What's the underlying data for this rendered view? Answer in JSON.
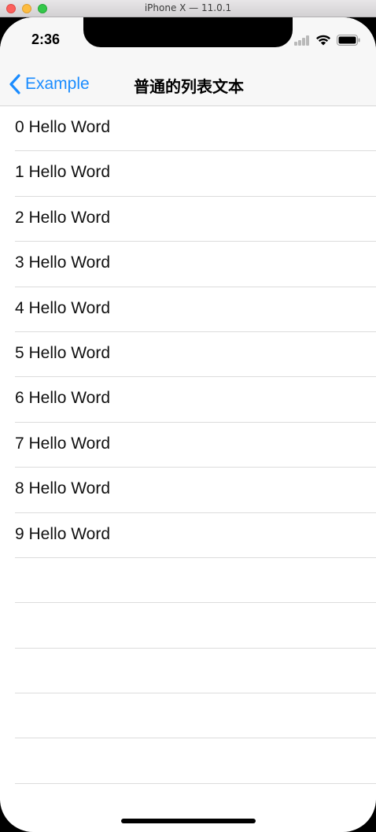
{
  "window": {
    "title": "iPhone X — 11.0.1"
  },
  "status_bar": {
    "time": "2:36"
  },
  "nav": {
    "back_label": "Example",
    "title": "普通的列表文本"
  },
  "list": {
    "items": [
      "0 Hello Word",
      "1 Hello Word",
      "2 Hello Word",
      "3 Hello Word",
      "4 Hello Word",
      "5 Hello Word",
      "6 Hello Word",
      "7 Hello Word",
      "8 Hello Word",
      "9 Hello Word",
      "",
      "",
      "",
      "",
      "",
      ""
    ]
  },
  "colors": {
    "accent": "#1a8cff",
    "separator": "#dcdcdc",
    "bar_bg": "#f7f7f7"
  }
}
